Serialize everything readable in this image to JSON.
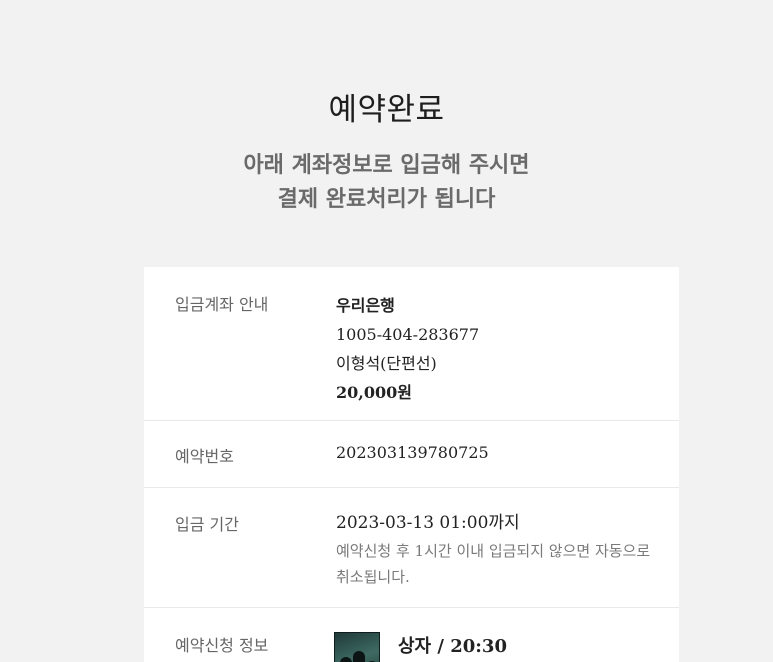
{
  "header": {
    "title": "예약완료",
    "subtitle_line1": "아래 계좌정보로 입금해 주시면",
    "subtitle_line2": "결제 완료처리가 됩니다"
  },
  "account": {
    "label": "입금계좌 안내",
    "bank": "우리은행",
    "number": "1005-404-283677",
    "holder": "이형석(단편선)",
    "amount": "20,000원"
  },
  "reservation": {
    "label": "예약번호",
    "number": "202303139780725"
  },
  "period": {
    "label": "입금 기간",
    "deadline": "2023-03-13 01:00까지",
    "note": "예약신청 후 1시간 이내 입금되지 않으면 자동으로 취소됩니다."
  },
  "info": {
    "label": "예약신청 정보",
    "show": "상자 / 20:30"
  }
}
